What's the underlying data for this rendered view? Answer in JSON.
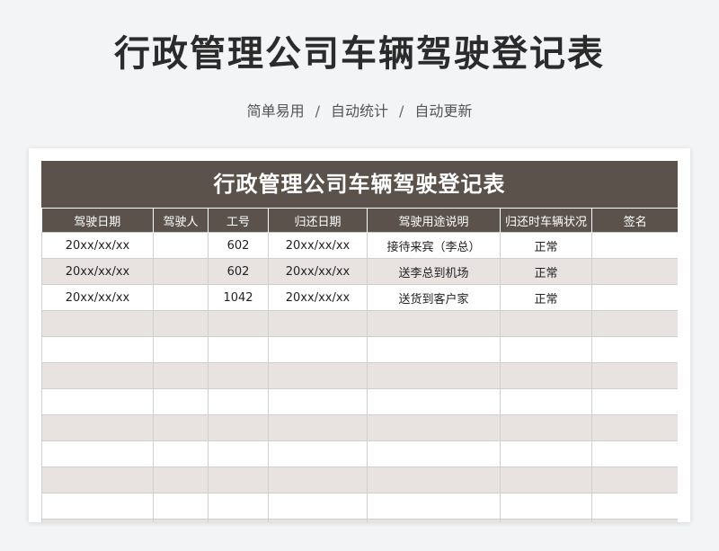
{
  "header": {
    "title": "行政管理公司车辆驾驶登记表",
    "subtitle_parts": [
      "简单易用",
      "自动统计",
      "自动更新"
    ],
    "separator": "/"
  },
  "sheet": {
    "title": "行政管理公司车辆驾驶登记表",
    "columns": [
      "驾驶日期",
      "驾驶人",
      "工号",
      "归还日期",
      "驾驶用途说明",
      "归还时车辆状况",
      "签名"
    ],
    "rows": [
      [
        "20xx/xx/xx",
        "",
        "602",
        "20xx/xx/xx",
        "接待来宾（李总）",
        "正常",
        ""
      ],
      [
        "20xx/xx/xx",
        "",
        "602",
        "20xx/xx/xx",
        "送李总到机场",
        "正常",
        ""
      ],
      [
        "20xx/xx/xx",
        "",
        "1042",
        "20xx/xx/xx",
        "送货到客户家",
        "正常",
        ""
      ],
      [
        "",
        "",
        "",
        "",
        "",
        "",
        ""
      ],
      [
        "",
        "",
        "",
        "",
        "",
        "",
        ""
      ],
      [
        "",
        "",
        "",
        "",
        "",
        "",
        ""
      ],
      [
        "",
        "",
        "",
        "",
        "",
        "",
        ""
      ],
      [
        "",
        "",
        "",
        "",
        "",
        "",
        ""
      ],
      [
        "",
        "",
        "",
        "",
        "",
        "",
        ""
      ],
      [
        "",
        "",
        "",
        "",
        "",
        "",
        ""
      ],
      [
        "",
        "",
        "",
        "",
        "",
        "",
        ""
      ],
      [
        "",
        "",
        "",
        "",
        "",
        "",
        ""
      ]
    ]
  },
  "colors": {
    "header_bg": "#5b534b",
    "stripe_bg": "#e8e3e1",
    "page_bg": "#f3f4f6"
  }
}
